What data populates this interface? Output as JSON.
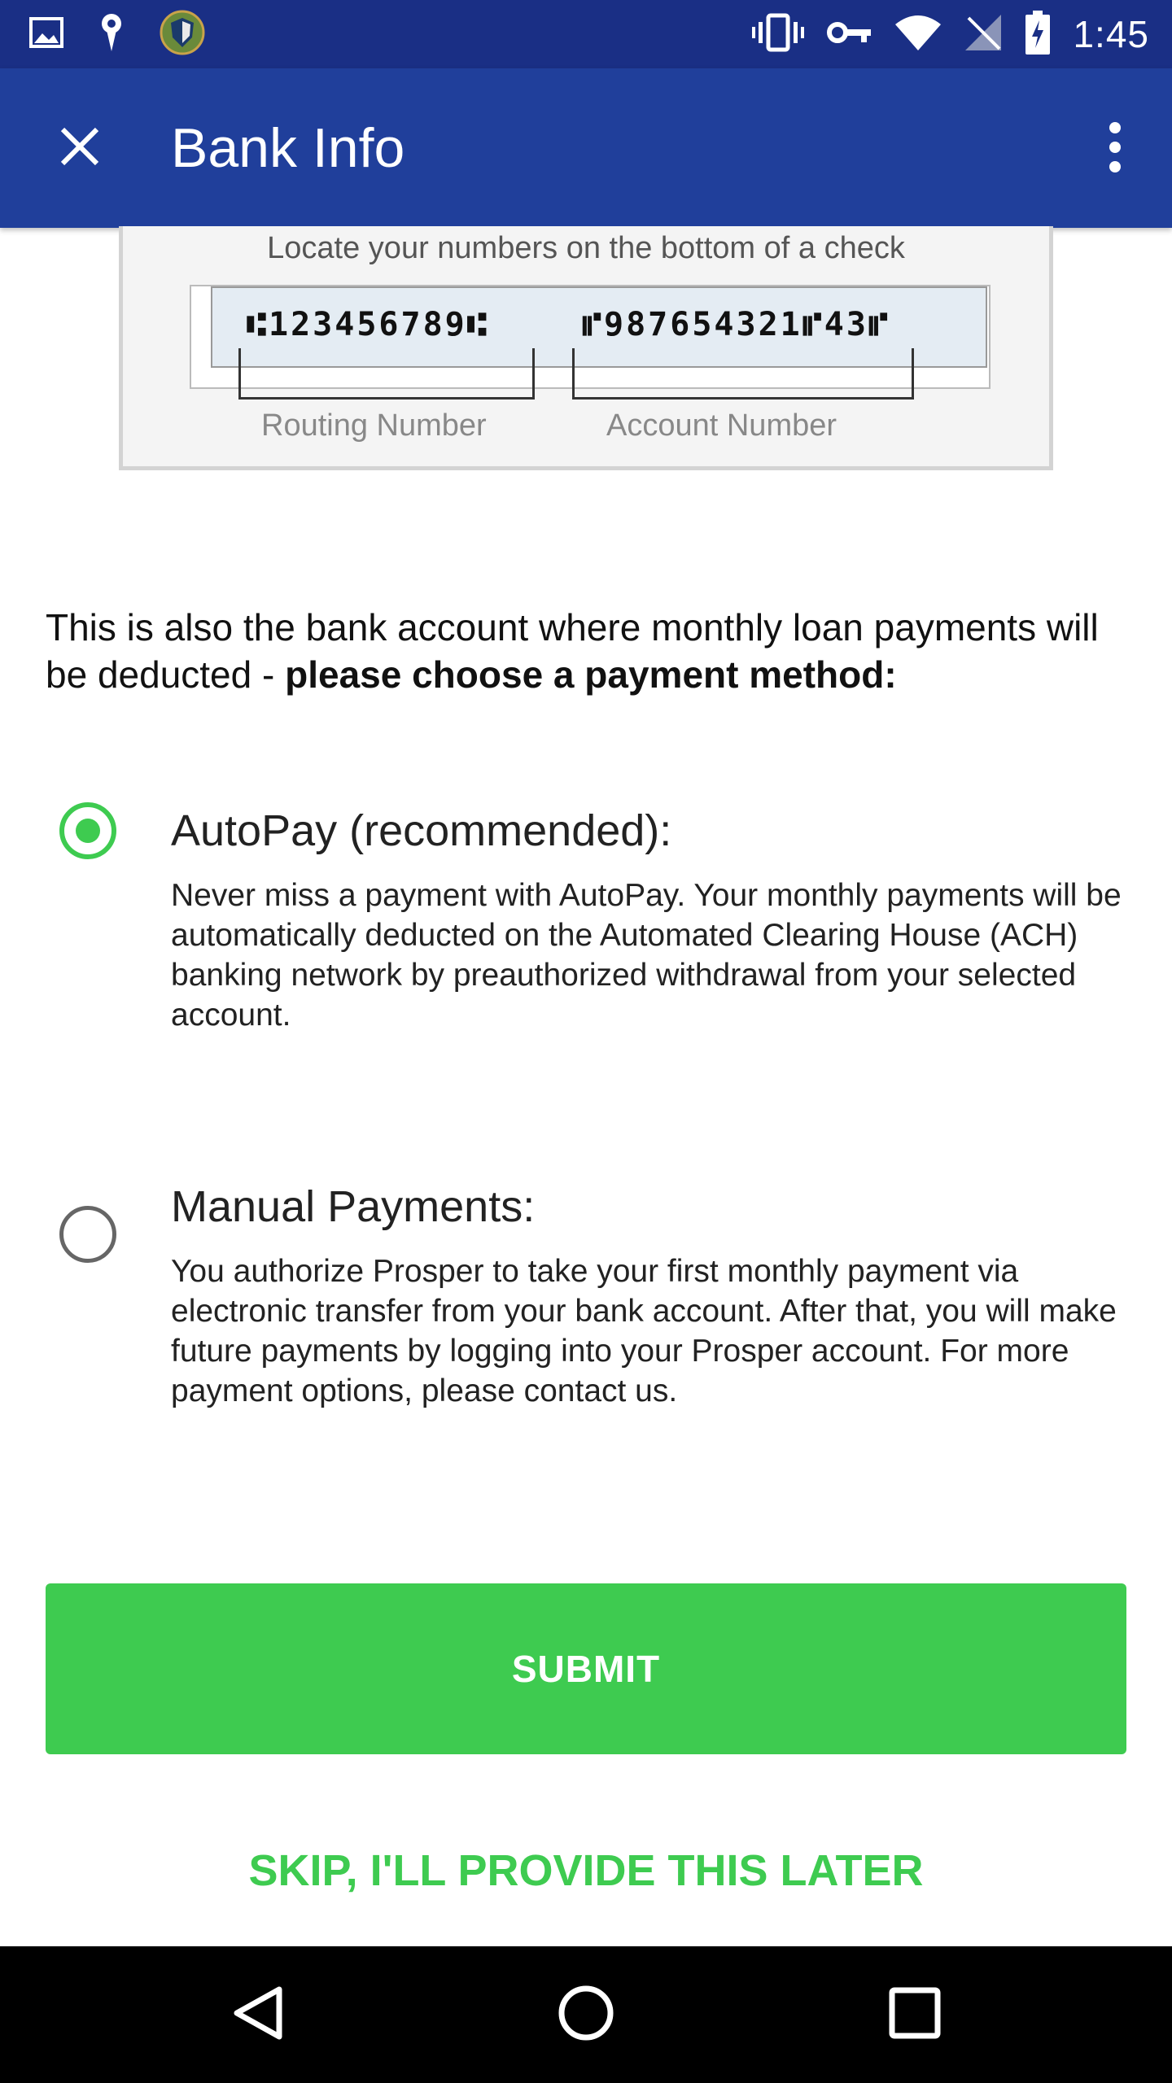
{
  "status_bar": {
    "time": "1:45",
    "left_icons": [
      "image-icon",
      "location-pin-icon",
      "shield-app-icon"
    ],
    "right_icons": [
      "vibrate-icon",
      "vpn-key-icon",
      "wifi-icon",
      "no-signal-icon",
      "battery-charging-icon"
    ]
  },
  "app_bar": {
    "title": "Bank Info",
    "close_icon": "close-icon",
    "menu_icon": "more-vert-icon",
    "color": "#203f9b"
  },
  "check_image": {
    "caption": "Locate your numbers on the bottom of a check",
    "routing_micr": "⑆123456789⑆",
    "account_micr": "⑈987654321⑈43⑈",
    "routing_label": "Routing Number",
    "account_label": "Account Number"
  },
  "intro": {
    "text": "This is also the bank account where monthly loan payments will be deducted - ",
    "bold": "please choose a payment method:"
  },
  "options": [
    {
      "title": "AutoPay (recommended):",
      "description": "Never miss a payment with AutoPay. Your monthly payments will be automatically deducted on the Automated Clearing House (ACH) banking network by preauthorized withdrawal from your selected account.",
      "selected": true
    },
    {
      "title": "Manual Payments:",
      "description": "You authorize Prosper to take your first monthly payment via electronic transfer from your bank account. After that, you will make future payments by logging into your Prosper account. For more payment options, please contact us.",
      "selected": false
    }
  ],
  "actions": {
    "submit_label": "SUBMIT",
    "skip_label": "SKIP, I'LL PROVIDE THIS LATER",
    "accent_color": "#3ecb50"
  },
  "nav_bar": {
    "icons": [
      "back-icon",
      "home-icon",
      "recents-icon"
    ]
  }
}
